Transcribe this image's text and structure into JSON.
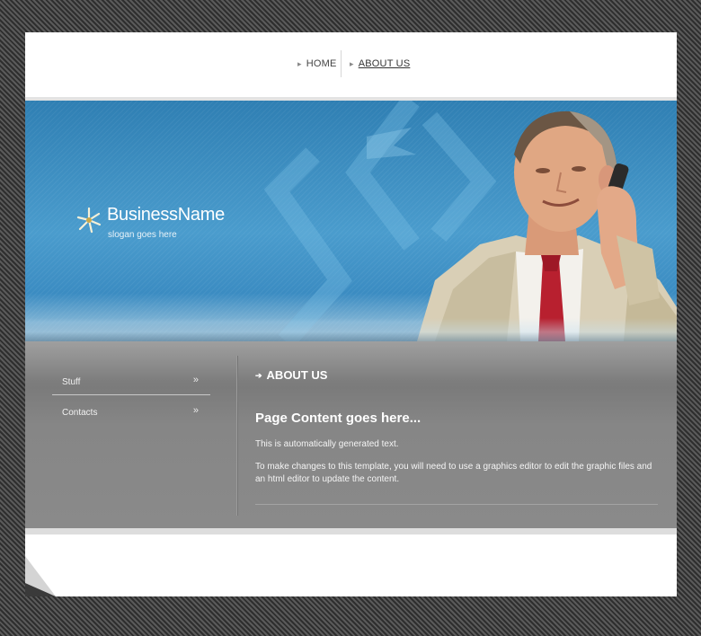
{
  "nav": {
    "items": [
      {
        "label": "HOME",
        "active": false
      },
      {
        "label": "ABOUT US",
        "active": true
      }
    ]
  },
  "header": {
    "brand_name": "BusinessName",
    "slogan": "slogan goes here",
    "logo_icon": "starburst-icon",
    "hero_image": "businessman-on-phone"
  },
  "sidebar": {
    "items": [
      {
        "label": "Stuff",
        "icon": "double-chevron-right-icon"
      },
      {
        "label": "Contacts",
        "icon": "double-chevron-right-icon"
      }
    ]
  },
  "main": {
    "section_title": "ABOUT US",
    "heading": "Page Content goes here...",
    "paragraphs": [
      "This is automatically generated text.",
      "To make changes to this template, you will need to use a graphics editor to edit the graphic files and an html editor to update the content."
    ]
  },
  "colors": {
    "header_blue": "#3b8cc2",
    "content_gray": "#868686",
    "text_white": "#ffffff"
  }
}
